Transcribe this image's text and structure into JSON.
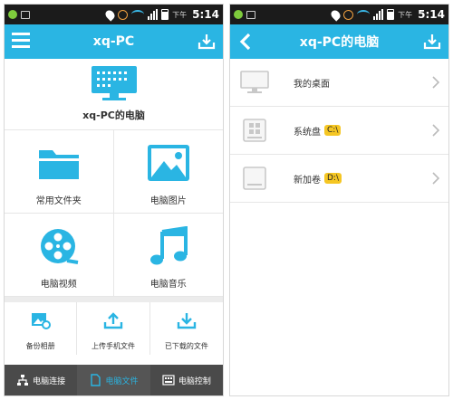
{
  "status_bar": {
    "time": "5:14",
    "carrier": "下午"
  },
  "left_screen": {
    "title": "xq-PC",
    "pc_name": "xq-PC的电脑",
    "grid": [
      {
        "label": "常用文件夹",
        "icon": "folder-icon"
      },
      {
        "label": "电脑图片",
        "icon": "image-icon"
      },
      {
        "label": "电脑视频",
        "icon": "film-reel-icon"
      },
      {
        "label": "电脑音乐",
        "icon": "music-note-icon"
      }
    ],
    "actions": [
      {
        "label": "备份相册",
        "icon": "backup-photo-icon"
      },
      {
        "label": "上传手机文件",
        "icon": "upload-icon"
      },
      {
        "label": "已下载的文件",
        "icon": "download-icon"
      }
    ],
    "tabs": [
      {
        "label": "电脑连接",
        "icon": "network-icon",
        "active": false
      },
      {
        "label": "电脑文件",
        "icon": "file-icon",
        "active": true
      },
      {
        "label": "电脑控制",
        "icon": "keyboard-icon",
        "active": false
      }
    ]
  },
  "right_screen": {
    "title": "xq-PC的电脑",
    "items": [
      {
        "label": "我的桌面",
        "badge": "",
        "icon": "monitor-icon"
      },
      {
        "label": "系统盘",
        "badge": "C:\\",
        "icon": "windows-drive-icon"
      },
      {
        "label": "新加卷",
        "badge": "D:\\",
        "icon": "hard-drive-icon"
      }
    ]
  },
  "colors": {
    "accent": "#2ab5e3",
    "badge": "#f5c623",
    "tabbar": "#4a4a4a"
  }
}
